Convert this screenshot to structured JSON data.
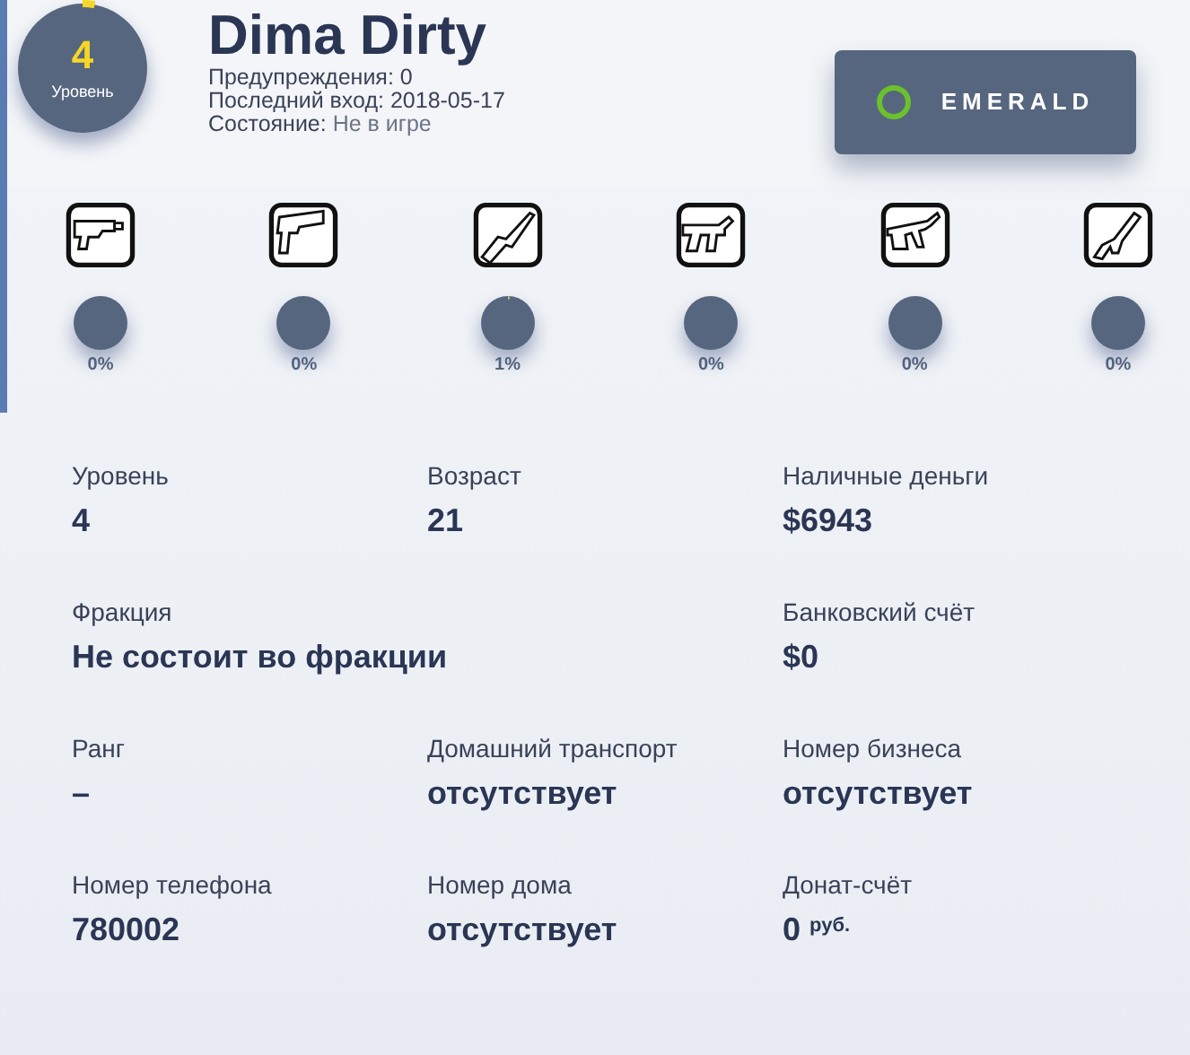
{
  "player": {
    "level": "4",
    "level_label": "Уровень",
    "name": "Dima Dirty",
    "info": [
      "Предупреждения: 0",
      "Последний вход: 2018-05-17"
    ],
    "status_label": "Состояние:",
    "status_value": "Не в игре"
  },
  "server": {
    "name": "EMERALD",
    "color": "#6cc02c"
  },
  "weapons": [
    {
      "skill": "0%"
    },
    {
      "skill": "0%"
    },
    {
      "skill": "1%"
    },
    {
      "skill": "0%"
    },
    {
      "skill": "0%"
    },
    {
      "skill": "0%"
    }
  ],
  "stats": [
    {
      "label": "Уровень",
      "value": "4",
      "kind": "normal"
    },
    {
      "label": "Возраст",
      "value": "21",
      "kind": "normal"
    },
    {
      "label": "Наличные деньги",
      "value": "$6943",
      "kind": "normal"
    },
    {
      "label": "Фракция",
      "value": "Не состоит во фракции",
      "kind": "wide"
    },
    {
      "label": "Банковский счёт",
      "value": "$0",
      "kind": "normal"
    },
    {
      "label": "Ранг",
      "value": "–",
      "kind": "normal"
    },
    {
      "label": "Домашний транспорт",
      "value": "отсутствует",
      "kind": "normal"
    },
    {
      "label": "Номер бизнеса",
      "value": "отсутствует",
      "kind": "normal"
    },
    {
      "label": "Номер телефона",
      "value": "780002",
      "kind": "normal"
    },
    {
      "label": "Номер дома",
      "value": "отсутствует",
      "kind": "normal"
    },
    {
      "label": "Донат-счёт",
      "value": "0 $^{руб.}$",
      "kind": "normal"
    }
  ]
}
